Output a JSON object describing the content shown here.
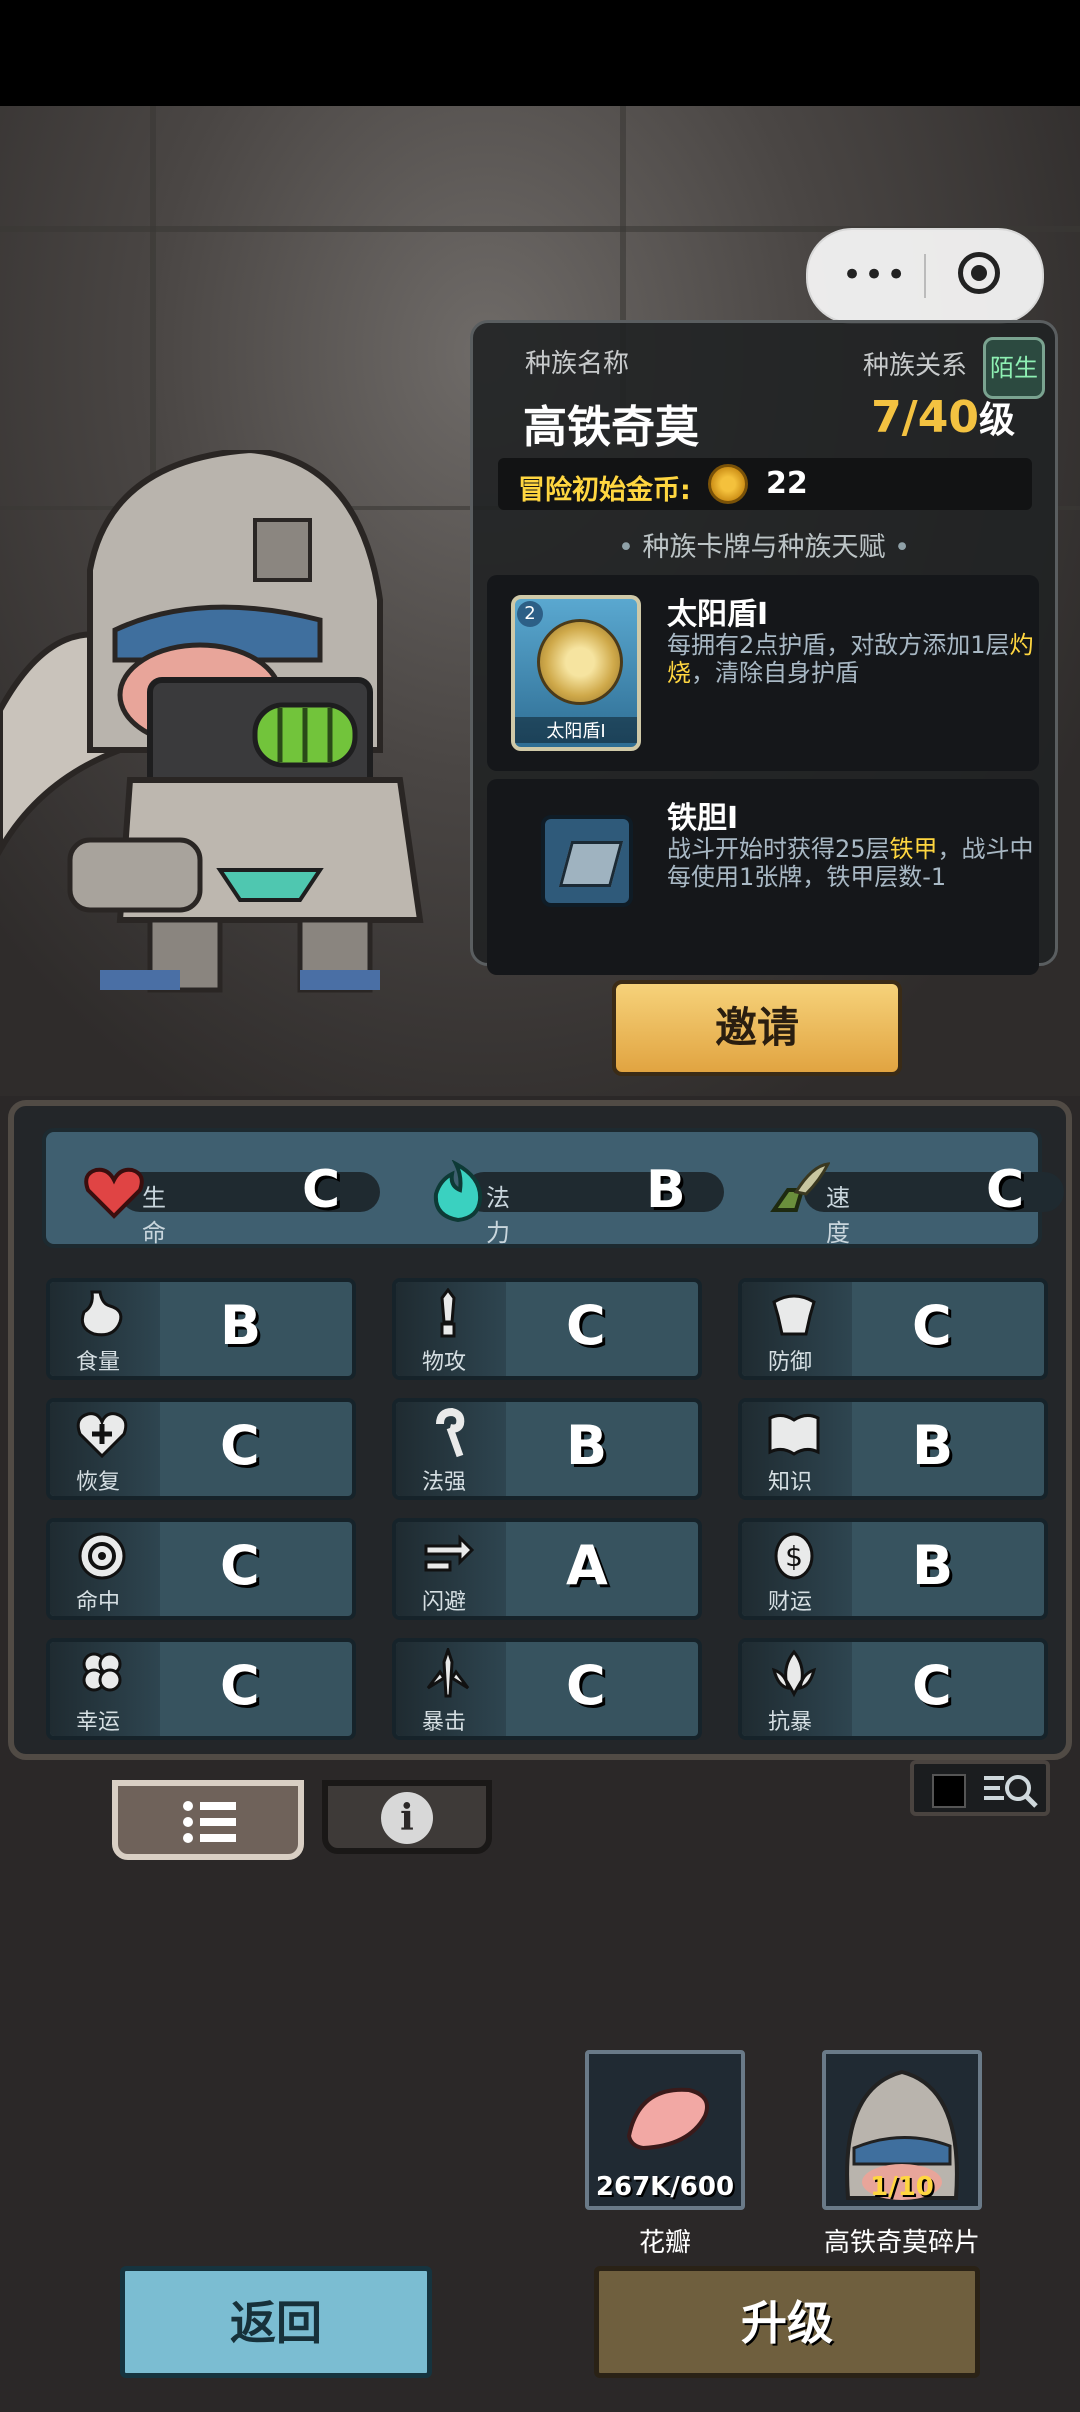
{
  "window": {
    "menu_dots": "•••"
  },
  "race": {
    "name_label": "种族名称",
    "name": "高铁奇莫",
    "relation_label": "种族关系",
    "relation": "陌生",
    "level_value": "7/40",
    "level_unit": "级",
    "coin_label": "冒险初始金币:",
    "coin_value": "22",
    "section_title": "种族卡牌与种族天赋",
    "cards": [
      {
        "title": "太阳盾I",
        "thumb_label": "太阳盾I",
        "cost": "2",
        "desc_a": "每拥有2点护盾，对敌方添加1层",
        "desc_hl": "灼烧",
        "desc_b": "，清除自身护盾"
      },
      {
        "title": "铁胆I",
        "desc_a": "战斗开始时获得25层",
        "desc_hl": "铁甲",
        "desc_b": "，战斗中每使用1张牌，铁甲层数-1"
      }
    ]
  },
  "invite_label": "邀请",
  "main_stats": [
    {
      "name": "生命",
      "grade": "C",
      "icon": "heart-icon"
    },
    {
      "name": "法力",
      "grade": "B",
      "icon": "flame-icon"
    },
    {
      "name": "速度",
      "grade": "C",
      "icon": "wing-boot-icon"
    }
  ],
  "attributes": [
    {
      "name": "食量",
      "grade": "B",
      "icon": "stomach-icon"
    },
    {
      "name": "物攻",
      "grade": "C",
      "icon": "sword-icon"
    },
    {
      "name": "防御",
      "grade": "C",
      "icon": "armor-icon"
    },
    {
      "name": "恢复",
      "grade": "C",
      "icon": "heart-plus-icon"
    },
    {
      "name": "法强",
      "grade": "B",
      "icon": "staff-icon"
    },
    {
      "name": "知识",
      "grade": "B",
      "icon": "book-icon"
    },
    {
      "name": "命中",
      "grade": "C",
      "icon": "target-icon"
    },
    {
      "name": "闪避",
      "grade": "A",
      "icon": "dodge-arrows-icon"
    },
    {
      "name": "财运",
      "grade": "B",
      "icon": "money-bag-icon"
    },
    {
      "name": "幸运",
      "grade": "C",
      "icon": "clover-icon"
    },
    {
      "name": "暴击",
      "grade": "C",
      "icon": "crit-swords-icon"
    },
    {
      "name": "抗暴",
      "grade": "C",
      "icon": "lotus-shield-icon"
    }
  ],
  "items": [
    {
      "name": "花瓣",
      "count": "267K/600",
      "icon": "petal-icon"
    },
    {
      "name": "高铁奇莫碎片",
      "count": "1/10",
      "icon": "race-fragment-icon"
    }
  ],
  "buttons": {
    "back": "返回",
    "upgrade": "升级"
  },
  "colors": {
    "gold": "#ffd640",
    "panel": "#202224",
    "stat_cell": "#37535f",
    "back_btn": "#7bbdd2",
    "upgrade_btn": "#6f5f3e"
  }
}
